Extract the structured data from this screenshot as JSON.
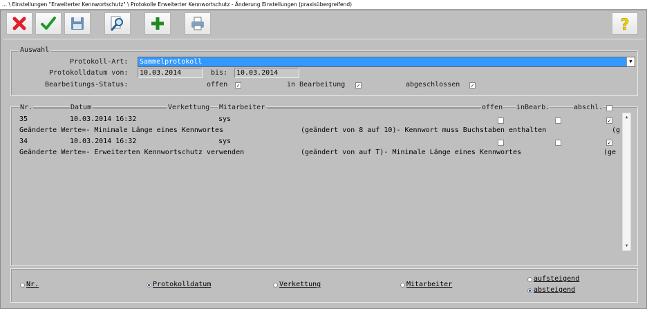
{
  "window": {
    "title": "... \\ Einstellungen \"Erweiterter Kennwortschutz\" \\ Protokolle Erweiterter Kennwortschutz - Änderung Einstellungen (praxisübergreifend)"
  },
  "toolbar": {
    "buttons": [
      {
        "name": "cancel",
        "icon": "red-x-icon"
      },
      {
        "name": "ok",
        "icon": "green-check-icon"
      },
      {
        "name": "save",
        "icon": "floppy-disk-icon"
      },
      {
        "name": "search",
        "icon": "magnifier-icon"
      },
      {
        "name": "add",
        "icon": "green-plus-icon"
      },
      {
        "name": "print",
        "icon": "printer-icon"
      },
      {
        "name": "help",
        "icon": "question-icon"
      }
    ]
  },
  "selection": {
    "title": "Auswahl",
    "protocol_type_label": "Protokoll-Art:",
    "protocol_type_value": "Sammelprotokoll",
    "date_from_label": "Protokolldatum von:",
    "date_from_value": "10.03.2014",
    "date_to_label": "bis:",
    "date_to_value": "10.03.2014",
    "status_label": "Bearbeitungs-Status:",
    "status_open_label": "offen",
    "status_open_checked": true,
    "status_inprogress_label": "in Bearbeitung",
    "status_inprogress_checked": true,
    "status_closed_label": "abgeschlossen",
    "status_closed_checked": true
  },
  "list": {
    "columns": {
      "nr": "Nr.",
      "datum": "Datum",
      "verkettung": "Verkettung",
      "mitarbeiter": "Mitarbeiter",
      "offen": "offen",
      "inbearb": "inBearb.",
      "abschl": "abschl."
    },
    "entries": [
      {
        "nr": "35",
        "datum": "10.03.2014 16:32",
        "mitarbeiter": "sys",
        "offen": false,
        "inbearb": false,
        "abschl": true,
        "detail_a": "Geänderte Werte=- Minimale Länge eines Kennwortes",
        "detail_b": "(geändert von 8 auf 10)- Kennwort muss Buchstaben enthalten",
        "detail_c": "(g"
      },
      {
        "nr": "34",
        "datum": "10.03.2014 16:32",
        "mitarbeiter": "sys",
        "offen": false,
        "inbearb": false,
        "abschl": true,
        "detail_a": "Geänderte Werte=- Erweiterten Kennwortschutz verwenden",
        "detail_b": "(geändert von  auf T)- Minimale Länge eines Kennwortes",
        "detail_c": "(ge"
      }
    ]
  },
  "sort": {
    "nr": "Nr.",
    "protokolldatum": "Protokolldatum",
    "verkettung": "Verkettung",
    "mitarbeiter": "Mitarbeiter",
    "aufsteigend": "aufsteigend",
    "absteigend": "absteigend",
    "selected_field": "protokolldatum",
    "selected_order": "absteigend"
  }
}
